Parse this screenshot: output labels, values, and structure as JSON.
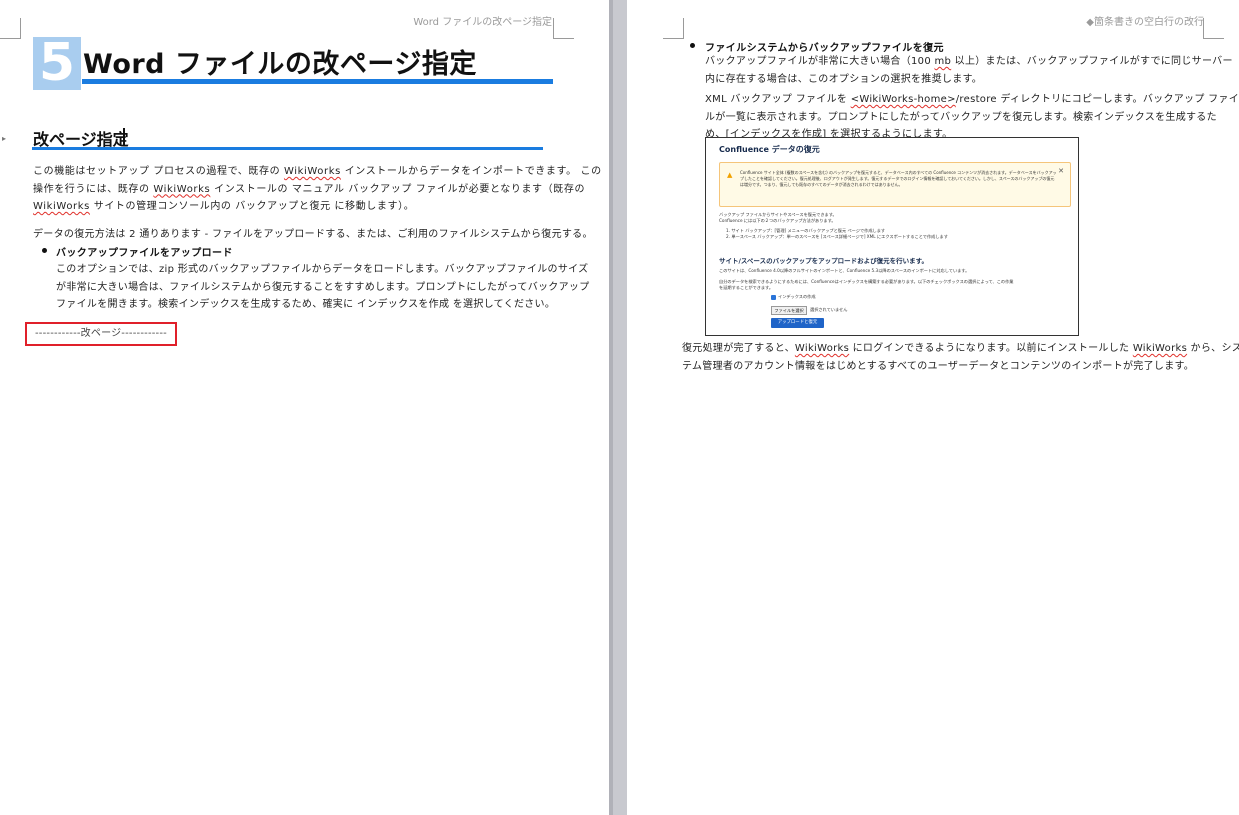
{
  "left_page": {
    "running_head": "Word ファイルの改ページ指定",
    "chapter_number": "5",
    "chapter_title": "Word ファイルの改ページ指定",
    "section_heading": "改ページ指定",
    "intro_paragraph": {
      "line1_prefix": "この機能はセットアップ プロセスの過程で、既存の ",
      "line1_app": "WikiWorks",
      "line1_suffix": " インストールからデータをインポートできます。 この",
      "line2_prefix": "操作を行うには、既存の ",
      "line2_app": "WikiWorks",
      "line2_suffix": " インストールの マニュアル バックアップ ファイルが必要となります（既存の",
      "line3_app": "WikiWorks",
      "line3_suffix": " サイトの管理コンソール内の バックアップと復元 に移動します）。"
    },
    "methods_sentence": "データの復元方法は 2 通りあります - ファイルをアップロードする、または、ご利用のファイルシステムから復元する。",
    "bullet1": {
      "title": "バックアップファイルをアップロード",
      "line1": "このオプションでは、zip 形式のバックアップファイルからデータをロードします。バックアップファイルのサイズ",
      "line2": "が非常に大きい場合は、ファイルシステムから復元することをすすめします。プロンプトにしたがってバックアップ",
      "line3": "ファイルを開きます。検索インデックスを生成するため、確実に インデックスを作成 を選択してください。"
    },
    "page_break_label": "------------改ページ------------"
  },
  "right_page": {
    "running_head": "◆箇条書きの空白行の改行",
    "bullet2": {
      "title": "ファイルシステムからバックアップファイルを復元",
      "line1_prefix": "バックアップファイルが非常に大きい場合（100 ",
      "line1_unit": "mb",
      "line1_suffix": " 以上）または、バックアップファイルがすでに同じサーバー",
      "line2": "内に存在する場合は、このオプションの選択を推奨します。",
      "line3_prefix": "XML バックアップ ファイルを ",
      "line3_path": "<WikiWorks-home>",
      "line3_suffix": "/restore ディレクトリにコピーします。バックアップ ファイ",
      "line4": "ルが一覧に表示されます。プロンプトにしたがってバックアップを復元します。検索インデックスを生成するた",
      "line5": "め、[インデックスを作成] を選択するようにします。"
    },
    "screenshot": {
      "title": "Confluence データの復元",
      "warning_text": "Confluence サイト全体 (複数のスペースを含む) のバックアップを復元すると、データベース内のすべての Confluence コンテンツが消去されます。データベースをバックアップしたことを確認してください。復元処理後、ログアウトが発生します。復元するデータでのログイン情報を確認しておいてください。しかし、スペースのバックアップの復元は増分です。つまり、復元しても既存のすべてのデータが消去されるわけではありません。",
      "intro1": "バックアップ ファイルからサイトやスペースを復元できます。",
      "intro2": "Confluence には以下の２つのバックアップ方法があります。",
      "list1": "1. サイト バックアップ：[管理] メニューのバックアップと復元 ページで作成します",
      "list2": "2. 単一スペース バックアップ：単一のスペースを [スペース詳細ページで] XML にエクスポートすることで作成します",
      "upload_heading": "サイト/スペースのバックアップをアップロードおよび復元を行います。",
      "compat": "このサイトは、Confluence 4.0以降のフルサイトのインポートと、Confluence 5.3以降のスペースのインポートに対応しています。",
      "search_note1": "自分のデータを検索できるようにするためには、Confluenceはインデックスを構築する必要があります。以下のチェックボックスの選択によって、この作業",
      "search_note2": "を延期することができます。",
      "checkbox_label": "インデックスの作成",
      "file_button": "ファイルを選択",
      "file_status": "選択されていません",
      "upload_button": "アップロードと復元"
    },
    "closing": {
      "line1_prefix": "復元処理が完了すると、",
      "line1_app": "WikiWorks",
      "line1_mid": " にログインできるようになります。以前にインストールした ",
      "line1_app2": "WikiWorks",
      "line1_suffix": " から、シス",
      "line2": "テム管理者のアカウント情報をはじめとするすべてのユーザーデータとコンテンツのインポートが完了します。"
    }
  },
  "colors": {
    "accent_blue": "#1a7ce0",
    "chapter_box": "#a9cdef",
    "page_break_border": "#e0202a",
    "spellcheck": "#e0302a"
  }
}
